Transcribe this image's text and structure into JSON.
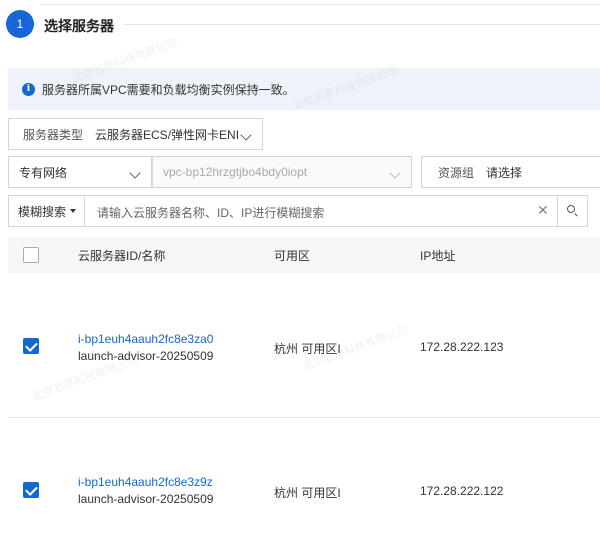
{
  "step": {
    "number": "1",
    "title": "选择服务器"
  },
  "notice": {
    "text": "服务器所属VPC需要和负载均衡实例保持一致。"
  },
  "filters": {
    "server_type_label": "服务器类型",
    "server_type_value": "云服务器ECS/弹性网卡ENI",
    "network_value": "专有网络",
    "vpc_value": "vpc-bp12hrzgtjbo4bdy0iopt",
    "resource_group_label": "资源组",
    "resource_group_placeholder": "请选择"
  },
  "search": {
    "mode": "模糊搜索",
    "placeholder": "请输入云服务器名称、ID、IP进行模糊搜索"
  },
  "table": {
    "headers": [
      "云服务器ID/名称",
      "可用区",
      "IP地址"
    ],
    "rows": [
      {
        "checked": true,
        "id": "i-bp1euh4aauh2fc8e3za0",
        "name": "launch-advisor-20250509",
        "zone": "杭州 可用区I",
        "ip": "172.28.222.123"
      },
      {
        "checked": true,
        "id": "i-bp1euh4aauh2fc8e3z9z",
        "name": "launch-advisor-20250509",
        "zone": "杭州 可用区I",
        "ip": "172.28.222.122"
      }
    ]
  },
  "watermark": {
    "text": "北京长亭科技有限公司"
  },
  "colors": {
    "accent": "#1766d6",
    "notice_bg": "#eef3fa",
    "header_bg": "#f5f6f8"
  }
}
